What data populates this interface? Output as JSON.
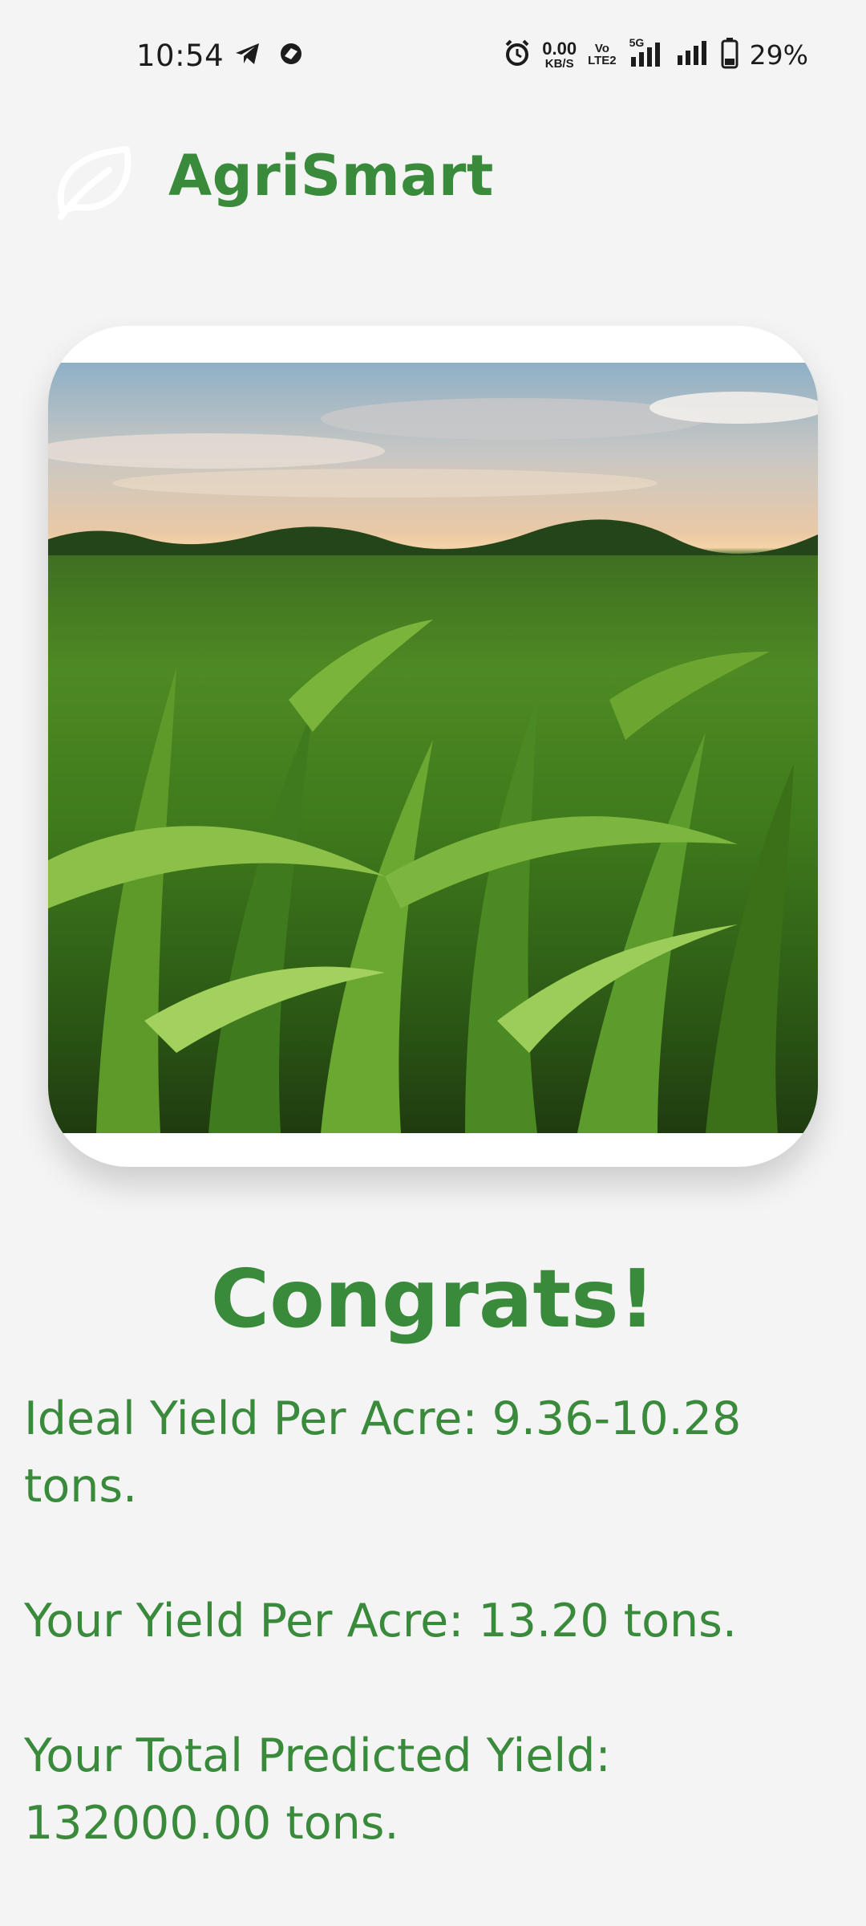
{
  "status_bar": {
    "time": "10:54",
    "net_speed_value": "0.00",
    "net_speed_unit": "KB/S",
    "volte_top": "Vo",
    "volte_bottom": "LTE2",
    "network_type": "5G",
    "battery_percent": "29%",
    "icons": [
      "telegram-icon",
      "app-notification-icon",
      "alarm-icon",
      "signal-5g-icon",
      "signal-icon",
      "battery-icon"
    ]
  },
  "header": {
    "app_name": "AgriSmart",
    "logo_icon": "leaf-icon"
  },
  "hero_image": {
    "subject": "cornfield-photo"
  },
  "result": {
    "heading": "Congrats!",
    "ideal_yield": "Ideal Yield Per Acre: 9.36-10.28 tons.",
    "your_yield": "Your Yield Per Acre: 13.20 tons.",
    "total_yield": "Your Total Predicted Yield: 132000.00 tons."
  },
  "colors": {
    "accent_green": "#3a8a3c",
    "background": "#f4f4f4",
    "card": "#ffffff"
  }
}
